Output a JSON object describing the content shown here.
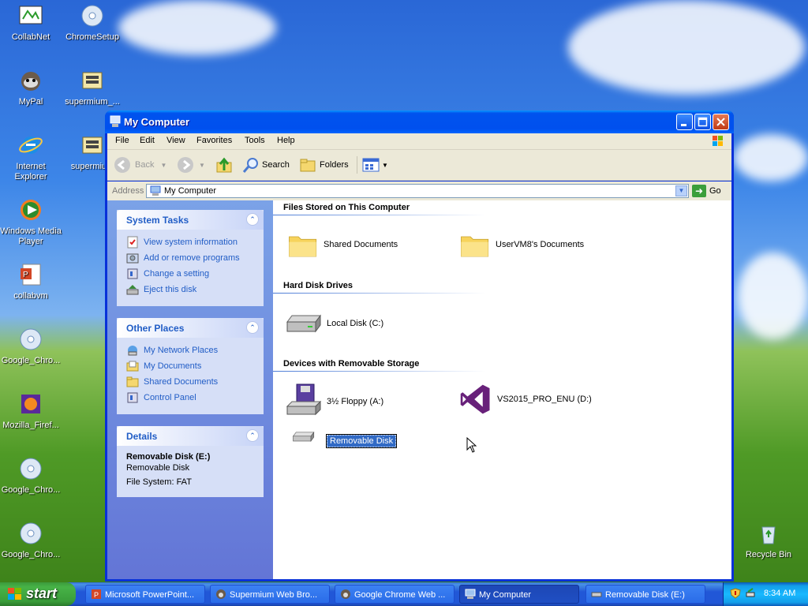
{
  "desktop": {
    "icons": [
      {
        "label": "CollabNet",
        "icon": "collabnet-icon"
      },
      {
        "label": "ChromeSetup",
        "icon": "installer-cd-icon"
      },
      {
        "label": "MyPal",
        "icon": "mypal-raccoon-icon"
      },
      {
        "label": "supermium_...",
        "icon": "installer-icon"
      },
      {
        "label": "Internet Explorer",
        "icon": "internet-explorer-icon"
      },
      {
        "label": "supermium",
        "icon": "installer-icon"
      },
      {
        "label": "Windows Media Player",
        "icon": "media-player-icon"
      },
      {
        "label": "collabvm",
        "icon": "powerpoint-file-icon"
      },
      {
        "label": "Google_Chro...",
        "icon": "installer-cd-icon"
      },
      {
        "label": "Mozilla_Firef...",
        "icon": "firefox-installer-icon"
      },
      {
        "label": "Google_Chro...",
        "icon": "installer-cd-icon"
      },
      {
        "label": "Google_Chro...",
        "icon": "installer-cd-icon"
      },
      {
        "label": "Recycle Bin",
        "icon": "recycle-bin-icon"
      }
    ]
  },
  "window": {
    "title": "My Computer",
    "menu": [
      "File",
      "Edit",
      "View",
      "Favorites",
      "Tools",
      "Help"
    ],
    "toolbar": {
      "back": "Back",
      "search": "Search",
      "folders": "Folders"
    },
    "address": {
      "label": "Address",
      "value": "My Computer",
      "go": "Go"
    },
    "tasks": {
      "system_tasks": {
        "title": "System Tasks",
        "links": [
          "View system information",
          "Add or remove programs",
          "Change a setting",
          "Eject this disk"
        ]
      },
      "other_places": {
        "title": "Other Places",
        "links": [
          "My Network Places",
          "My Documents",
          "Shared Documents",
          "Control Panel"
        ]
      },
      "details": {
        "title": "Details",
        "name": "Removable Disk (E:)",
        "type": "Removable Disk",
        "fs": "File System: FAT"
      }
    },
    "groups": {
      "files": {
        "title": "Files Stored on This Computer",
        "items": [
          "Shared Documents",
          "UserVM8's Documents"
        ]
      },
      "hdd": {
        "title": "Hard Disk Drives",
        "items": [
          "Local Disk (C:)"
        ]
      },
      "removable": {
        "title": "Devices with Removable Storage",
        "items": [
          "3½ Floppy (A:)",
          "VS2015_PRO_ENU (D:)",
          "Removable Disk"
        ]
      }
    }
  },
  "taskbar": {
    "start": "start",
    "tasks": [
      "Microsoft PowerPoint...",
      "Supermium Web Bro...",
      "Google Chrome Web ...",
      "My Computer",
      "Removable Disk (E:)"
    ],
    "active_task": "My Computer",
    "clock": "8:34 AM"
  },
  "colors": {
    "titlebar": "#0053ee",
    "task_link": "#215dc6",
    "selection": "#316ac5"
  }
}
